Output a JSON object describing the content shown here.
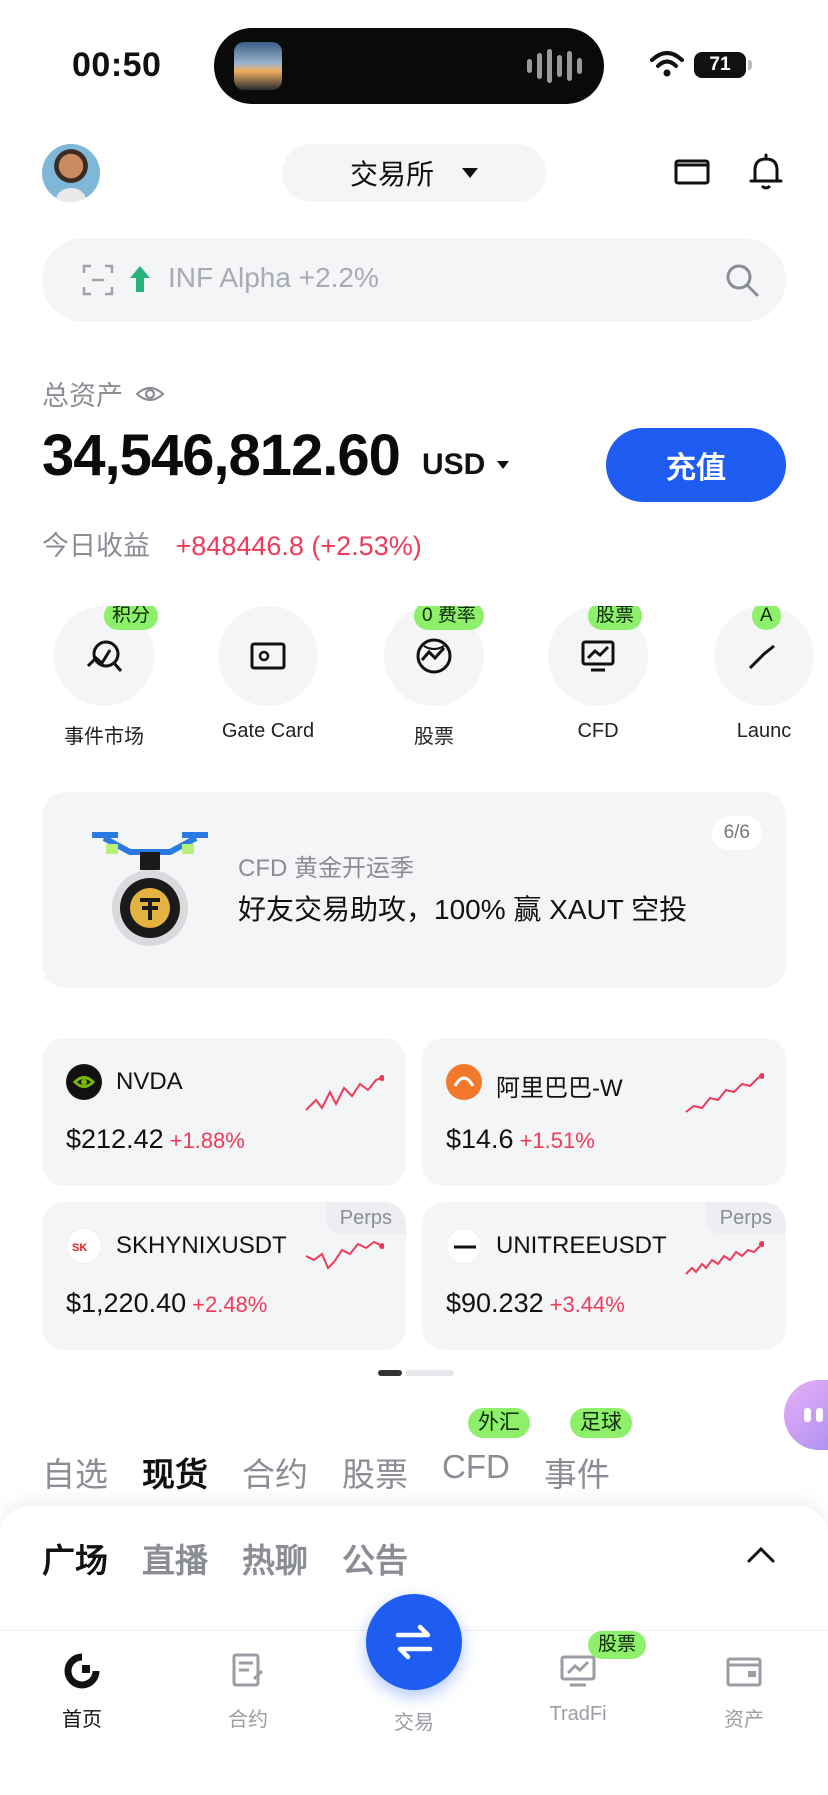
{
  "status_bar": {
    "time": "00:50",
    "battery": "71"
  },
  "header": {
    "exchange_label": "交易所"
  },
  "search": {
    "placeholder": "INF Alpha +2.2%"
  },
  "assets": {
    "label": "总资产",
    "balance": "34,546,812.60",
    "currency": "USD",
    "deposit_label": "充值",
    "pnl_label": "今日收益",
    "pnl_value": "+848446.8 (+2.53%)",
    "pnl_color": "#ef3b59"
  },
  "quick_actions": [
    {
      "label": "事件市场",
      "tag": "积分",
      "icon": "event-market-icon"
    },
    {
      "label": "Gate Card",
      "tag": "",
      "icon": "card-icon"
    },
    {
      "label": "股票",
      "tag": "0 费率",
      "icon": "stocks-globe-icon"
    },
    {
      "label": "CFD",
      "tag": "股票",
      "icon": "cfd-chart-icon"
    },
    {
      "label": "Launc",
      "tag": "A",
      "icon": "launch-icon"
    }
  ],
  "banner": {
    "pager": "6/6",
    "subtitle": "CFD 黄金开运季",
    "title": "好友交易助攻，100% 赢 XAUT 空投"
  },
  "tickers": [
    {
      "name": "NVDA",
      "price": "$212.42",
      "change": "+1.88%",
      "perps": ""
    },
    {
      "name": "阿里巴巴-W",
      "price": "$14.6",
      "change": "+1.51%",
      "perps": ""
    },
    {
      "name": "SKHYNIXUSDT",
      "price": "$1,220.40",
      "change": "+2.48%",
      "perps": "Perps"
    },
    {
      "name": "UNITREEUSDT",
      "price": "$90.232",
      "change": "+3.44%",
      "perps": "Perps"
    }
  ],
  "market_tabs": [
    {
      "label": "自选",
      "tag": ""
    },
    {
      "label": "现货",
      "tag": ""
    },
    {
      "label": "合约",
      "tag": ""
    },
    {
      "label": "股票",
      "tag": ""
    },
    {
      "label": "CFD",
      "tag": "外汇"
    },
    {
      "label": "事件",
      "tag": "足球"
    }
  ],
  "feed_tabs": [
    "广场",
    "直播",
    "热聊",
    "公告"
  ],
  "bottom_nav": [
    {
      "label": "首页",
      "tag": ""
    },
    {
      "label": "合约",
      "tag": ""
    },
    {
      "label": "交易",
      "tag": ""
    },
    {
      "label": "TradFi",
      "tag": "股票"
    },
    {
      "label": "资产",
      "tag": ""
    }
  ],
  "colors": {
    "accent": "#1f5cf2",
    "up": "#ef3b59",
    "tag": "#8ef06a",
    "surface": "#f4f5f7"
  }
}
